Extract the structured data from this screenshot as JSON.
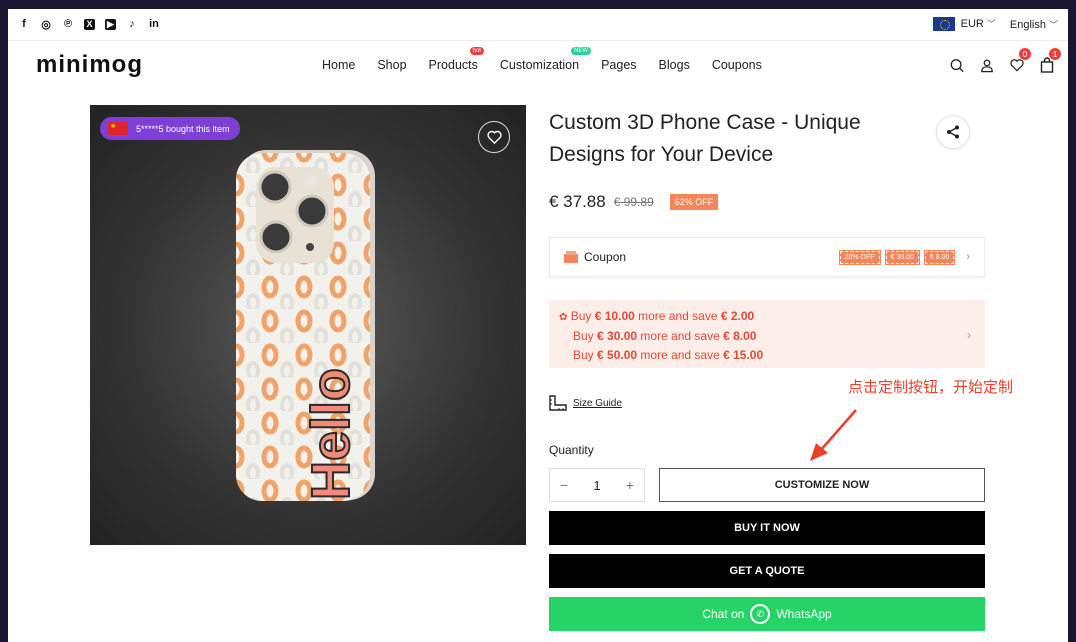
{
  "topbar": {
    "social": [
      {
        "icon": "facebook-icon",
        "glyph": "f"
      },
      {
        "icon": "instagram-icon",
        "glyph": "◎"
      },
      {
        "icon": "pinterest-icon",
        "glyph": "℗"
      },
      {
        "icon": "x-icon",
        "glyph": "X"
      },
      {
        "icon": "youtube-icon",
        "glyph": "▶"
      },
      {
        "icon": "tiktok-icon",
        "glyph": "♪"
      },
      {
        "icon": "linkedin-icon",
        "glyph": "in"
      }
    ],
    "currency": "EUR",
    "language": "English"
  },
  "header": {
    "logo": "minimog",
    "nav": [
      {
        "label": "Home"
      },
      {
        "label": "Shop"
      },
      {
        "label": "Products",
        "badge": "hot"
      },
      {
        "label": "Customization",
        "badge": "NEW"
      },
      {
        "label": "Pages"
      },
      {
        "label": "Blogs"
      },
      {
        "label": "Coupons"
      }
    ],
    "wishlist_count": "0",
    "cart_count": "1"
  },
  "product": {
    "bought_text": "5*****5 bought this item",
    "case_text": "Hello",
    "title": "Custom 3D Phone Case - Unique Designs for Your Device",
    "price_now": "€ 37.88",
    "price_old": "€ 99.89",
    "discount": "62% OFF",
    "coupon": {
      "label": "Coupon",
      "tags": [
        "20% OFF",
        "€ 30.00",
        "€ 8.00"
      ]
    },
    "promo": [
      {
        "pre": "Buy ",
        "amount": "€ 10.00",
        "mid": " more and save ",
        "save": "€ 2.00"
      },
      {
        "pre": "Buy ",
        "amount": "€ 30.00",
        "mid": " more and save ",
        "save": "€ 8.00"
      },
      {
        "pre": "Buy ",
        "amount": "€ 50.00",
        "mid": " more and save ",
        "save": "€ 15.00"
      }
    ],
    "annotation": "点击定制按钮，开始定制",
    "size_guide": "Size Guide",
    "quantity_label": "Quantity",
    "quantity": "1",
    "btn_customize": "CUSTOMIZE NOW",
    "btn_buy": "BUY IT NOW",
    "btn_quote": "GET A QUOTE",
    "btn_chat_pre": "Chat on",
    "btn_chat_app": "WhatsApp"
  },
  "colors": {
    "accent_orange": "#f5855a",
    "promo_red": "#e24a34",
    "whatsapp_green": "#25d366",
    "badge_purple": "#7d3fd6"
  }
}
